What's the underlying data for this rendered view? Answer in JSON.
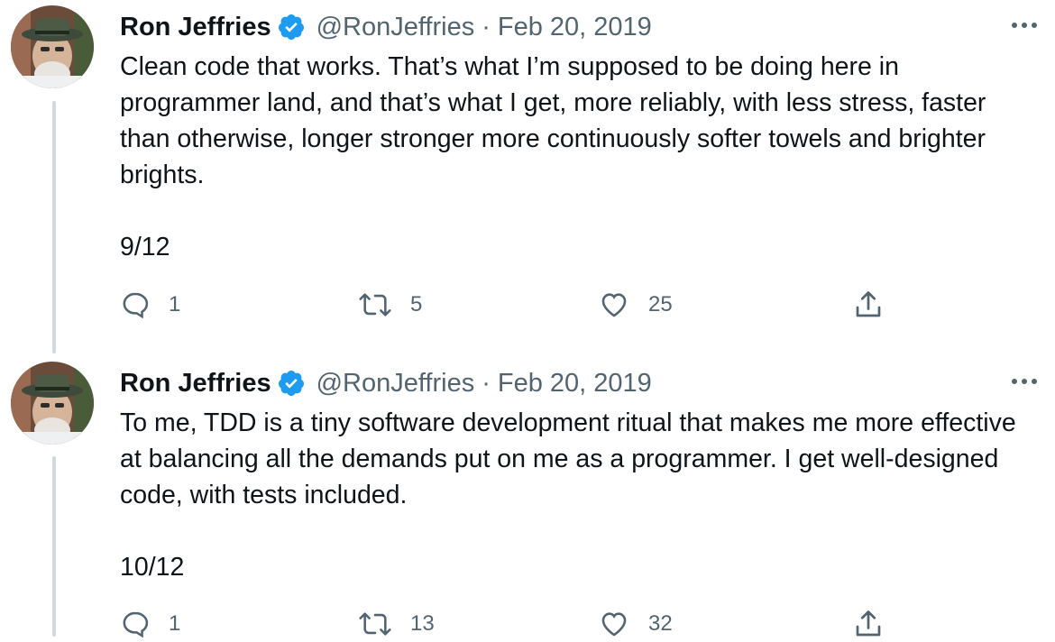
{
  "tweets": [
    {
      "author": {
        "name": "Ron Jeffries",
        "handle": "@RonJeffries",
        "verified": true,
        "avatar": "avatar-icon"
      },
      "separator": "·",
      "date": "Feb 20, 2019",
      "text": "Clean code that works. That’s what I’m supposed to be doing here in programmer land, and that’s what I get, more reliably, with less stress, faster than otherwise, longer stronger more continuously softer towels and brighter brights.\n\n9/12",
      "counts": {
        "replies": "1",
        "retweets": "5",
        "likes": "25"
      }
    },
    {
      "author": {
        "name": "Ron Jeffries",
        "handle": "@RonJeffries",
        "verified": true,
        "avatar": "avatar-icon"
      },
      "separator": "·",
      "date": "Feb 20, 2019",
      "text": "To me, TDD is a tiny software development ritual that makes me more effective at balancing all the demands put on me as a programmer. I get well-designed code, with tests included.\n\n10/12",
      "counts": {
        "replies": "1",
        "retweets": "13",
        "likes": "32"
      }
    }
  ],
  "icons": {
    "more": "more-horizontal-icon",
    "reply": "reply-icon",
    "retweet": "retweet-icon",
    "like": "heart-icon",
    "share": "share-icon",
    "verified": "verified-badge-icon"
  },
  "colors": {
    "text": "#0f1419",
    "secondary": "#536471",
    "verified": "#1d9bf0",
    "thread_line": "#cfd9de"
  }
}
